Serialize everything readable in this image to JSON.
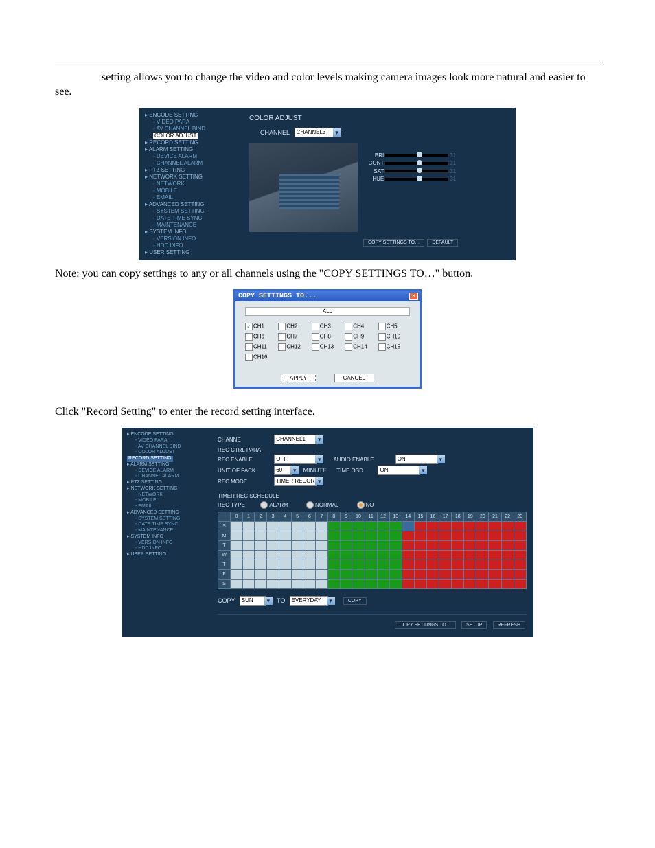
{
  "text": {
    "intro": "setting allows you to change the video and color levels making camera images look more natural and easier to see.",
    "note_copy": "Note: you can copy settings to any or all channels using the \"COPY SETTINGS TO…\" button.",
    "click_record": "Click \"Record Setting\" to enter the record setting interface."
  },
  "color_panel": {
    "tree": [
      "ENCODE SETTING",
      " VIDEO PARA",
      " AV CHANNEL BIND",
      " COLOR ADJUST",
      "RECORD SETTING",
      "ALARM SETTING",
      " DEVICE ALARM",
      " CHANNEL ALARM",
      "PTZ SETTING",
      "NETWORK SETTING",
      " NETWORK",
      " MOBILE",
      " EMAIL",
      "ADVANCED SETTING",
      " SYSTEM SETTING",
      " DATE TIME SYNC",
      " MAINTENANCE",
      "SYSTEM INFO",
      " VERSION INFO",
      " HDD INFO",
      "USER SETTING"
    ],
    "tree_sel_index": 3,
    "title": "COLOR ADJUST",
    "channel_label": "CHANNEL",
    "channel_value": "CHANNEL3",
    "sliders": [
      {
        "label": "BRI",
        "value": "31"
      },
      {
        "label": "CONT",
        "value": "31"
      },
      {
        "label": "SAT",
        "value": "31"
      },
      {
        "label": "HUE",
        "value": "31"
      }
    ],
    "btn_copy": "COPY SETTINGS TO…",
    "btn_default": "DEFAULT"
  },
  "copy_dialog": {
    "title": "COPY SETTINGS TO...",
    "all": "ALL",
    "channels": [
      "CH1",
      "CH2",
      "CH3",
      "CH4",
      "CH5",
      "CH6",
      "CH7",
      "CH8",
      "CH9",
      "CH10",
      "CH11",
      "CH12",
      "CH13",
      "CH14",
      "CH15",
      "CH16"
    ],
    "checked_index": 0,
    "apply": "APPLY",
    "cancel": "CANCEL"
  },
  "record_panel": {
    "tree": [
      "ENCODE SETTING",
      " VIDEO PARA",
      " AV CHANNEL BIND",
      " COLOR ADJUST",
      "RECORD SETTING",
      "ALARM SETTING",
      " DEVICE ALARM",
      " CHANNEL ALARM",
      "PTZ SETTING",
      "NETWORK SETTING",
      " NETWORK",
      " MOBILE",
      " EMAIL",
      "ADVANCED SETTING",
      " SYSTEM SETTING",
      " DATE TIME SYNC",
      " MAINTENANCE",
      "SYSTEM INFO",
      " VERSION INFO",
      " HDD INFO",
      "USER SETTING"
    ],
    "tree_sel_index": 4,
    "channel_label": "CHANNE",
    "channel_value": "CHANNEL1",
    "subheader": "REC CTRL PARA",
    "fields": {
      "rec_enable_l": "REC ENABLE",
      "rec_enable_v": "OFF",
      "audio_enable_l": "AUDIO ENABLE",
      "audio_enable_v": "ON",
      "unit_pack_l": "UNIT OF PACK",
      "unit_pack_v": "60",
      "unit_pack_suffix": "MINUTE",
      "time_osd_l": "TIME OSD",
      "time_osd_v": "ON",
      "rec_mode_l": "REC.MODE",
      "rec_mode_v": "TIMER RECOR"
    },
    "sched_header": "TIMER REC SCHEDULE",
    "rec_type_l": "REC TYPE",
    "radios": {
      "alarm": "ALARM",
      "normal": "NORMAL",
      "no": "NO",
      "selected": "no"
    },
    "hours": [
      "0",
      "1",
      "2",
      "3",
      "4",
      "5",
      "6",
      "7",
      "8",
      "9",
      "10",
      "11",
      "12",
      "13",
      "14",
      "15",
      "16",
      "17",
      "18",
      "19",
      "20",
      "21",
      "22",
      "23"
    ],
    "days": [
      "S",
      "M",
      "T",
      "W",
      "T",
      "F",
      "S"
    ],
    "schedule_map": [
      "wwwwwwwwggggggxrrrrrrrrr",
      "wwwwwwwwggggggrrrrrrrrrr",
      "wwwwwwwwggggggrrrrrrrrrr",
      "wwwwwwwwggggggrrrrrrrrrr",
      "wwwwwwwwggggggrrrrrrrrrr",
      "wwwwwwwwggggggrrrrrrrrrr",
      "wwwwwwwwggggggrrrrrrrrrr"
    ],
    "copy_l": "COPY",
    "copy_from": "SUN",
    "copy_to_l": "TO",
    "copy_to": "EVERYDAY",
    "copy_btn": "COPY",
    "btn_copy_settings": "COPY SETTINGS TO…",
    "btn_setup": "SETUP",
    "btn_refresh": "REFRESH"
  }
}
